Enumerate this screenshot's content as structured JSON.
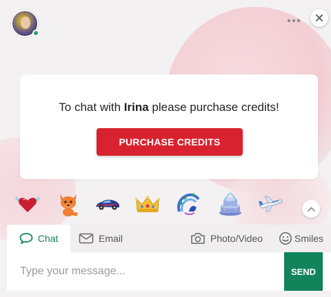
{
  "header": {
    "contact_name": "Irina",
    "online": true,
    "more_icon": "more-horizontal-icon",
    "close_icon": "close-icon"
  },
  "card": {
    "message_before": "To chat with ",
    "message_name": "Irina",
    "message_after": " please purchase credits!",
    "purchase_label": "PURCHASE CREDITS"
  },
  "gifts": [
    "heart-wings",
    "fox",
    "sports-car",
    "crown",
    "peacock",
    "fountain",
    "airplane"
  ],
  "tabs": {
    "chat": "Chat",
    "email": "Email",
    "photo_video": "Photo/Video",
    "smiles": "Smiles"
  },
  "composer": {
    "placeholder": "Type your message...",
    "send_label": "SEND"
  },
  "colors": {
    "accent_red": "#d9222f",
    "accent_green": "#12835a",
    "online_green": "#2e9e6a"
  }
}
